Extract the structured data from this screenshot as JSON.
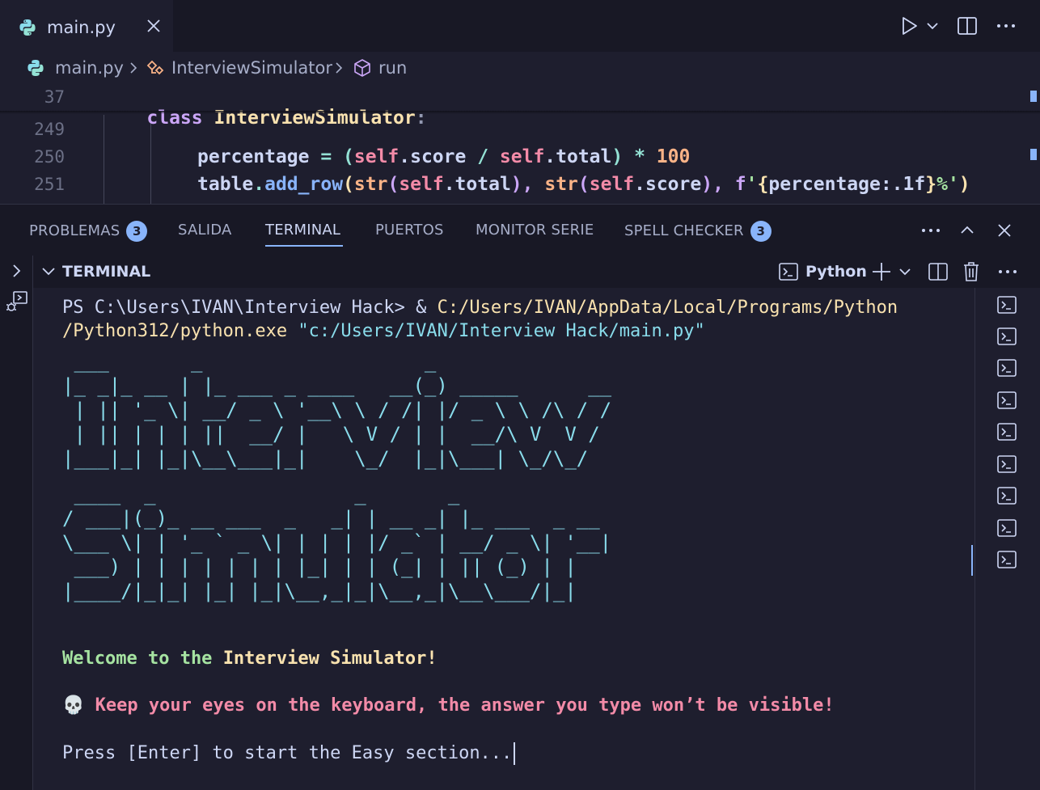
{
  "editor": {
    "tab_label": "main.py",
    "breadcrumb": {
      "file": "main.py",
      "class": "InterviewSimulator",
      "method": "run"
    },
    "lines": [
      {
        "number": "37"
      },
      {
        "number": "249"
      },
      {
        "number": "250"
      },
      {
        "number": "251"
      }
    ],
    "code": {
      "l37_kw": "class",
      "l37_name": "InterviewSimulator",
      "l37_colon": ":",
      "l250_var": "percentage",
      "l250_eq": " = (",
      "l250_self1": "self",
      "l250_attr1": ".score",
      "l250_div": " / ",
      "l250_self2": "self",
      "l250_attr2": ".total",
      "l250_mul": ") * ",
      "l250_num": "100",
      "l251_obj": "table",
      "l251_dot": ".",
      "l251_fn": "add_row",
      "l251_p1": "(",
      "l251_str1": "str",
      "l251_a1": "(",
      "l251_self1": "self",
      "l251_at1": ".total",
      "l251_c1": "), ",
      "l251_str2": "str",
      "l251_a2": "(",
      "l251_self2": "self",
      "l251_at2": ".score",
      "l251_c2": "), ",
      "l251_f": "f",
      "l251_q1": "'",
      "l251_b1": "{",
      "l251_fexpr": "percentage:.1f",
      "l251_b2": "}",
      "l251_pct": "%'",
      "l251_end": ")"
    }
  },
  "panel": {
    "tabs": [
      {
        "label": "PROBLEMAS",
        "badge": "3"
      },
      {
        "label": "SALIDA"
      },
      {
        "label": "TERMINAL"
      },
      {
        "label": "PUERTOS"
      },
      {
        "label": "MONITOR SERIE"
      },
      {
        "label": "SPELL CHECKER",
        "badge": "3"
      }
    ]
  },
  "terminal": {
    "section_title": "TERMINAL",
    "shell_label": "Python",
    "prompt": "PS C:\\Users\\IVAN\\Interview Hack> & ",
    "exe_path_1": "C:/Users/IVAN/AppData/Local/Programs/Python",
    "exe_path_2": "/Python312/python.exe",
    "script_arg": " \"c:/Users/IVAN/Interview Hack/main.py\"",
    "ascii_interview": " ___       _                   _\n|_ _|_ __ | |_ ___ _ ____   __(_) _____      __\n | || '_ \\| __/ _ \\ '__\\ \\ / /| |/ _ \\ \\ /\\ / /\n | || | | | ||  __/ |   \\ V / | |  __/\\ V  V /\n|___|_| |_|\\__\\___|_|    \\_/  |_|\\___| \\_/\\_/",
    "ascii_simulator": " ____  _                 _       _\n/ ___|(_)_ __ ___  _   _| | __ _| |_ ___  _ __\n\\___ \\| | '_ ` _ \\| | | | |/ _` | __/ _ \\| '__|\n ___) | | | | | | | |_| | | (_| | || (_) | |\n|____/|_|_| |_| |_|\\__,_|_|\\__,_|\\__\\___/|_|",
    "welcome_1": "Welcome to the ",
    "welcome_2": "Interview Simulator!",
    "warning_emoji": "💀",
    "warning": " Keep your eyes on the keyboard, the answer you type won’t be visible!",
    "press": "Press [Enter] to start the Easy section..."
  },
  "colors": {
    "keyword": "#cba6f7",
    "class_name": "#f9e2af",
    "self": "#f38ba8",
    "function": "#89b4fa",
    "builtin": "#fab387",
    "string": "#a6e3a1",
    "number": "#fab387",
    "ascii": "#89dceb",
    "path": "#f9e2af",
    "warning": "#f38ba8"
  }
}
